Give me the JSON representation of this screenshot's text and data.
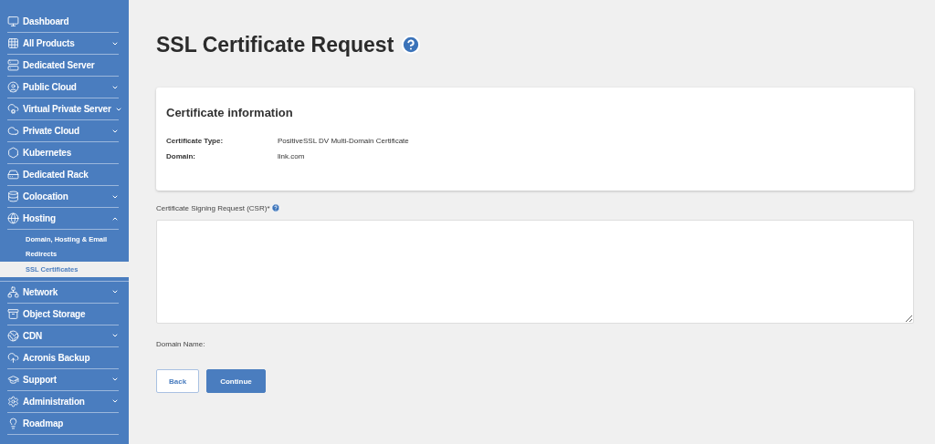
{
  "sidebar": {
    "items": [
      {
        "label": "Dashboard",
        "expandable": false
      },
      {
        "label": "All Products",
        "expandable": true,
        "expanded": false
      },
      {
        "label": "Dedicated Server",
        "expandable": false
      },
      {
        "label": "Public Cloud",
        "expandable": true,
        "expanded": false
      },
      {
        "label": "Virtual Private Server",
        "expandable": true,
        "expanded": false
      },
      {
        "label": "Private Cloud",
        "expandable": true,
        "expanded": false
      },
      {
        "label": "Kubernetes",
        "expandable": false
      },
      {
        "label": "Dedicated Rack",
        "expandable": false
      },
      {
        "label": "Colocation",
        "expandable": true,
        "expanded": false
      },
      {
        "label": "Hosting",
        "expandable": true,
        "expanded": true,
        "children": [
          {
            "label": "Domain, Hosting & Email",
            "selected": false
          },
          {
            "label": "Redirects",
            "selected": false
          },
          {
            "label": "SSL Certificates",
            "selected": true
          }
        ]
      },
      {
        "label": "Network",
        "expandable": true,
        "expanded": false
      },
      {
        "label": "Object Storage",
        "expandable": false
      },
      {
        "label": "CDN",
        "expandable": true,
        "expanded": false
      },
      {
        "label": "Acronis Backup",
        "expandable": false
      },
      {
        "label": "Support",
        "expandable": true,
        "expanded": false
      },
      {
        "label": "Administration",
        "expandable": true,
        "expanded": false
      },
      {
        "label": "Roadmap",
        "expandable": false
      }
    ]
  },
  "page": {
    "title": "SSL Certificate Request"
  },
  "card": {
    "title": "Certificate information",
    "rows": [
      {
        "label": "Certificate Type:",
        "value": "PositiveSSL DV Multi-Domain Certificate"
      },
      {
        "label": "Domain:",
        "value": "link.com"
      }
    ]
  },
  "csr": {
    "label": "Certificate Signing Request (CSR)*"
  },
  "domain_name": {
    "label": "Domain Name:"
  },
  "buttons": [
    {
      "label": "Back",
      "kind": "secondary"
    },
    {
      "label": "Continue",
      "kind": "primary"
    }
  ]
}
